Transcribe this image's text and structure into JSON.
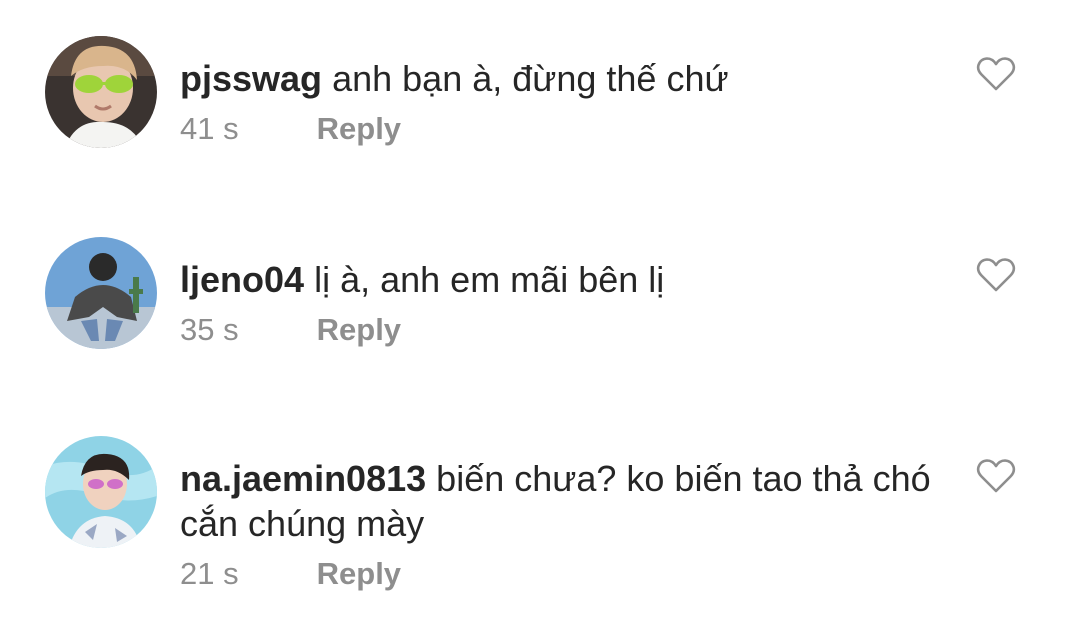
{
  "comments": [
    {
      "username": "pjsswag",
      "text": "anh bạn à, đừng thế chứ",
      "time": "41 s",
      "reply_label": "Reply",
      "avatar_icon": "avatar-person-sunglasses",
      "like_icon": "heart-outline-icon"
    },
    {
      "username": "ljeno04",
      "text": "lị à, anh em mãi bên lị",
      "time": "35 s",
      "reply_label": "Reply",
      "avatar_icon": "avatar-person-crouching",
      "like_icon": "heart-outline-icon"
    },
    {
      "username": "na.jaemin0813",
      "text": "biến chưa? ko biến tao thả chó cắn chúng mày",
      "time": "21 s",
      "reply_label": "Reply",
      "avatar_icon": "avatar-person-pool",
      "like_icon": "heart-outline-icon"
    }
  ],
  "colors": {
    "text": "#262626",
    "muted": "#8e8e8e",
    "heart_stroke": "#8e8e8e",
    "background": "#ffffff"
  }
}
